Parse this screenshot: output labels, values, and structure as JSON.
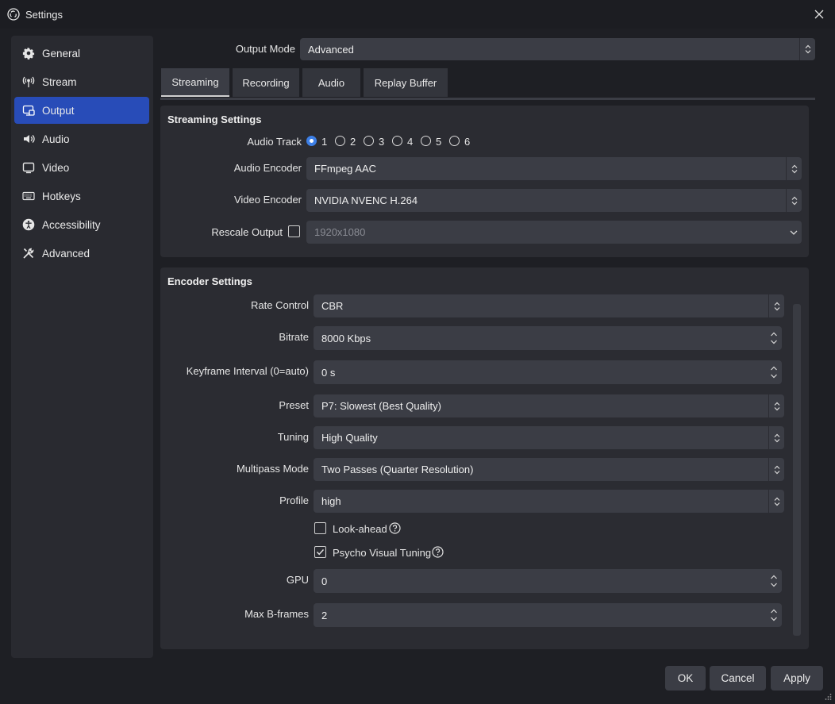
{
  "window": {
    "title": "Settings"
  },
  "sidebar": {
    "items": [
      {
        "label": "General",
        "icon": "gear-icon"
      },
      {
        "label": "Stream",
        "icon": "antenna-icon"
      },
      {
        "label": "Output",
        "icon": "output-icon",
        "active": true
      },
      {
        "label": "Audio",
        "icon": "speaker-icon"
      },
      {
        "label": "Video",
        "icon": "monitor-icon"
      },
      {
        "label": "Hotkeys",
        "icon": "keyboard-icon"
      },
      {
        "label": "Accessibility",
        "icon": "accessibility-icon"
      },
      {
        "label": "Advanced",
        "icon": "tools-icon"
      }
    ]
  },
  "output_mode": {
    "label": "Output Mode",
    "value": "Advanced"
  },
  "tabs": [
    {
      "label": "Streaming",
      "active": true
    },
    {
      "label": "Recording"
    },
    {
      "label": "Audio"
    },
    {
      "label": "Replay Buffer"
    }
  ],
  "streaming": {
    "title": "Streaming Settings",
    "audio_track": {
      "label": "Audio Track",
      "options": [
        "1",
        "2",
        "3",
        "4",
        "5",
        "6"
      ],
      "selected": "1"
    },
    "audio_encoder": {
      "label": "Audio Encoder",
      "value": "FFmpeg AAC"
    },
    "video_encoder": {
      "label": "Video Encoder",
      "value": "NVIDIA NVENC H.264"
    },
    "rescale": {
      "label": "Rescale Output",
      "checked": false,
      "value": "1920x1080"
    }
  },
  "encoder": {
    "title": "Encoder Settings",
    "rate_control": {
      "label": "Rate Control",
      "value": "CBR"
    },
    "bitrate": {
      "label": "Bitrate",
      "value": "8000 Kbps"
    },
    "keyframe": {
      "label": "Keyframe Interval (0=auto)",
      "value": "0 s"
    },
    "preset": {
      "label": "Preset",
      "value": "P7: Slowest (Best Quality)"
    },
    "tuning": {
      "label": "Tuning",
      "value": "High Quality"
    },
    "multipass": {
      "label": "Multipass Mode",
      "value": "Two Passes (Quarter Resolution)"
    },
    "profile": {
      "label": "Profile",
      "value": "high"
    },
    "lookahead": {
      "label": "Look-ahead",
      "checked": false
    },
    "psycho": {
      "label": "Psycho Visual Tuning",
      "checked": true
    },
    "gpu": {
      "label": "GPU",
      "value": "0"
    },
    "bframes": {
      "label": "Max B-frames",
      "value": "2"
    }
  },
  "buttons": {
    "ok": "OK",
    "cancel": "Cancel",
    "apply": "Apply"
  },
  "colors": {
    "accent": "#284cb8",
    "radio_on": "#3d7fe6",
    "field": "#3b3d45",
    "panel": "#2b2c32"
  }
}
